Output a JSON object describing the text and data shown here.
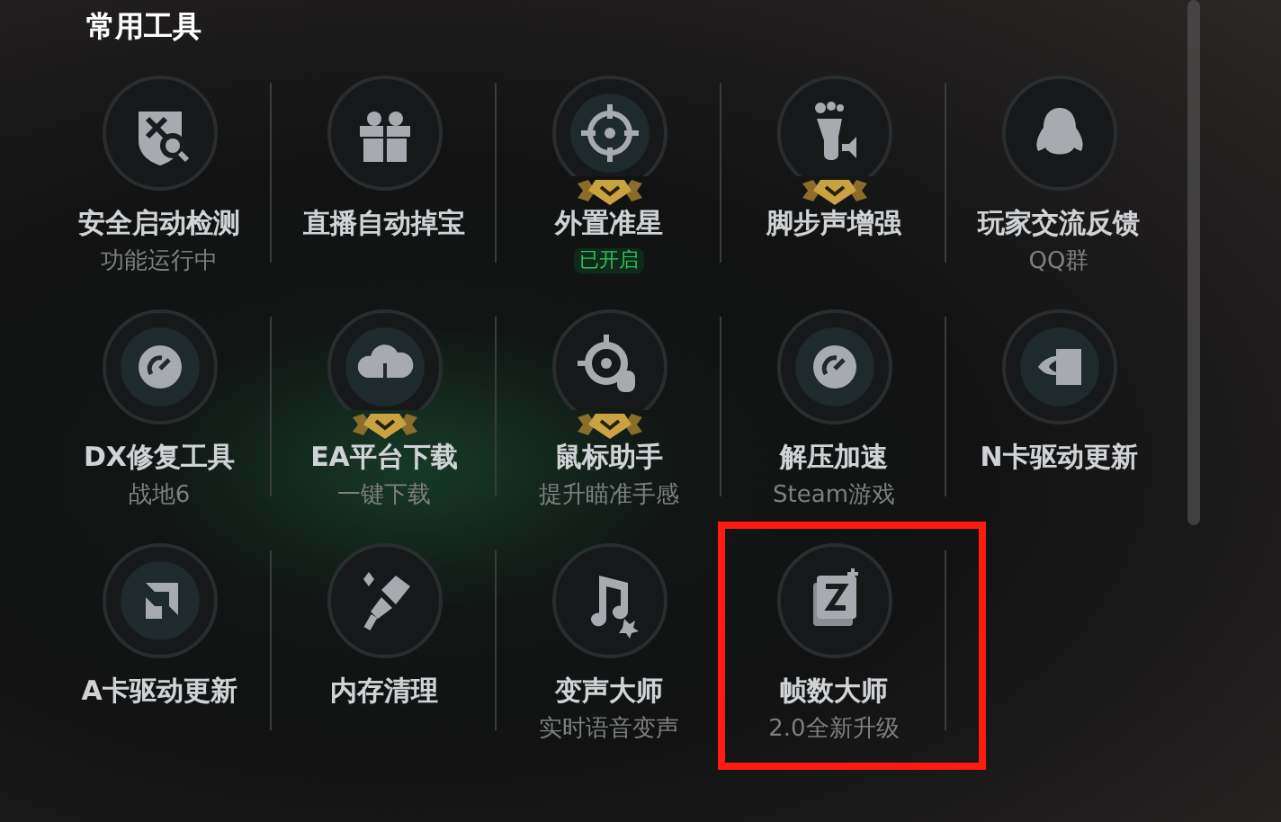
{
  "section": {
    "title": "常用工具"
  },
  "tools": [
    {
      "label": "安全启动检测",
      "subtitle": {
        "text": "功能运行中",
        "kind": "note"
      },
      "badge": false,
      "highlighted": false
    },
    {
      "label": "直播自动掉宝",
      "badge": false,
      "highlighted": false
    },
    {
      "label": "外置准星",
      "subtitle": {
        "text": "已开启",
        "kind": "status"
      },
      "badge": true,
      "highlighted": false
    },
    {
      "label": "脚步声增强",
      "badge": true,
      "highlighted": false
    },
    {
      "label": "玩家交流反馈",
      "subtitle": {
        "text": "QQ群",
        "kind": "note"
      },
      "badge": false,
      "highlighted": false
    },
    {
      "label": "DX修复工具",
      "subtitle": {
        "text": "战地6",
        "kind": "note"
      },
      "badge": false,
      "highlighted": false
    },
    {
      "label": "EA平台下载",
      "subtitle": {
        "text": "一键下载",
        "kind": "note"
      },
      "badge": true,
      "highlighted": false
    },
    {
      "label": "鼠标助手",
      "subtitle": {
        "text": "提升瞄准手感",
        "kind": "note"
      },
      "badge": true,
      "highlighted": false
    },
    {
      "label": "解压加速",
      "subtitle": {
        "text": "Steam游戏",
        "kind": "note"
      },
      "badge": false,
      "highlighted": false
    },
    {
      "label": "N卡驱动更新",
      "badge": false,
      "highlighted": false
    },
    {
      "label": "A卡驱动更新",
      "badge": false,
      "highlighted": false
    },
    {
      "label": "内存清理",
      "badge": false,
      "highlighted": false
    },
    {
      "label": "变声大师",
      "subtitle": {
        "text": "实时语音变声",
        "kind": "note"
      },
      "badge": false,
      "highlighted": false
    },
    {
      "label": "帧数大师",
      "subtitle": {
        "text": "2.0全新升级",
        "kind": "note"
      },
      "badge": false,
      "highlighted": true
    }
  ]
}
